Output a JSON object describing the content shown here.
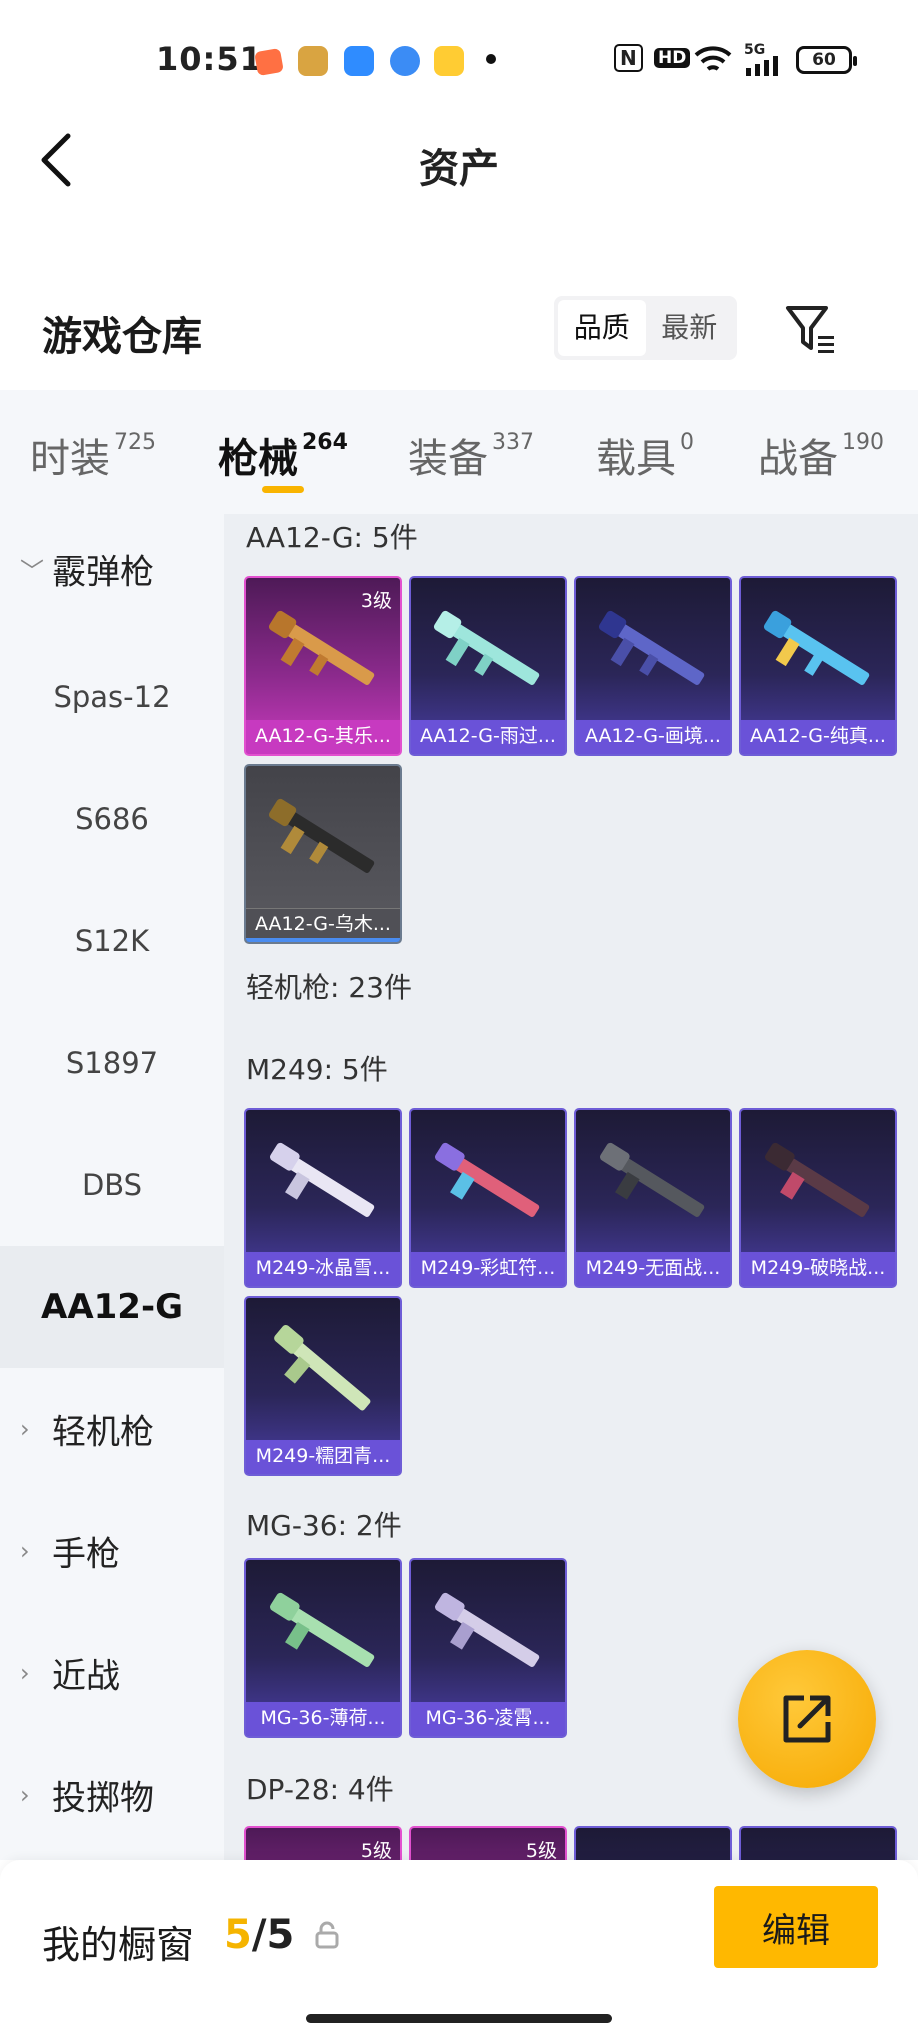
{
  "status_bar": {
    "time": "10:51",
    "nfc": "N",
    "hd": "HD",
    "network": "5G",
    "battery": "60"
  },
  "header": {
    "title": "资产"
  },
  "section": {
    "title": "游戏仓库",
    "sort_options": [
      "品质",
      "最新"
    ],
    "active_sort": "品质"
  },
  "tabs": [
    {
      "label": "时装",
      "count": "725"
    },
    {
      "label": "枪械",
      "count": "264"
    },
    {
      "label": "装备",
      "count": "337"
    },
    {
      "label": "载具",
      "count": "0"
    },
    {
      "label": "战备",
      "count": "190"
    }
  ],
  "active_tab": "枪械",
  "sidebar": {
    "categories": [
      {
        "label": "霰弹枪",
        "expanded": true
      },
      {
        "label": "轻机枪",
        "expanded": false
      },
      {
        "label": "手枪",
        "expanded": false
      },
      {
        "label": "近战",
        "expanded": false
      },
      {
        "label": "投掷物",
        "expanded": false
      }
    ],
    "subitems": [
      "Spas-12",
      "S686",
      "S12K",
      "S1897",
      "DBS",
      "AA12-G"
    ],
    "active_subitem": "AA12-G"
  },
  "content": {
    "aa12_title": "AA12-G: 5件",
    "lmg_title": "轻机枪: 23件",
    "m249_title": "M249: 5件",
    "mg36_title": "MG-36: 2件",
    "dp28_title": "DP-28: 4件",
    "aa12_items": [
      {
        "name": "AA12-G-其乐...",
        "level": "3级",
        "rarity": "pink"
      },
      {
        "name": "AA12-G-雨过...",
        "rarity": "purple"
      },
      {
        "name": "AA12-G-画境...",
        "rarity": "purple"
      },
      {
        "name": "AA12-G-纯真...",
        "rarity": "purple"
      },
      {
        "name": "AA12-G-乌木...",
        "rarity": "gray"
      }
    ],
    "m249_items": [
      {
        "name": "M249-冰晶雪...",
        "rarity": "purple"
      },
      {
        "name": "M249-彩虹符...",
        "rarity": "purple"
      },
      {
        "name": "M249-无面战...",
        "rarity": "purple"
      },
      {
        "name": "M249-破晓战...",
        "rarity": "purple"
      },
      {
        "name": "M249-糯团青...",
        "rarity": "purple"
      }
    ],
    "mg36_items": [
      {
        "name": "MG-36-薄荷...",
        "rarity": "purple"
      },
      {
        "name": "MG-36-凌霄...",
        "rarity": "purple"
      }
    ],
    "dp28_items": [
      {
        "level": "5级",
        "rarity": "pink"
      },
      {
        "level": "5级",
        "rarity": "pink"
      },
      {
        "rarity": "purple"
      },
      {
        "rarity": "purple"
      }
    ]
  },
  "bottom_bar": {
    "label": "我的橱窗",
    "current": "5",
    "separator": "/",
    "total": "5",
    "edit_label": "编辑"
  },
  "colors": {
    "accent": "#f9b400",
    "purple_card": "#6a52d8",
    "pink_card": "#c73ac0"
  }
}
